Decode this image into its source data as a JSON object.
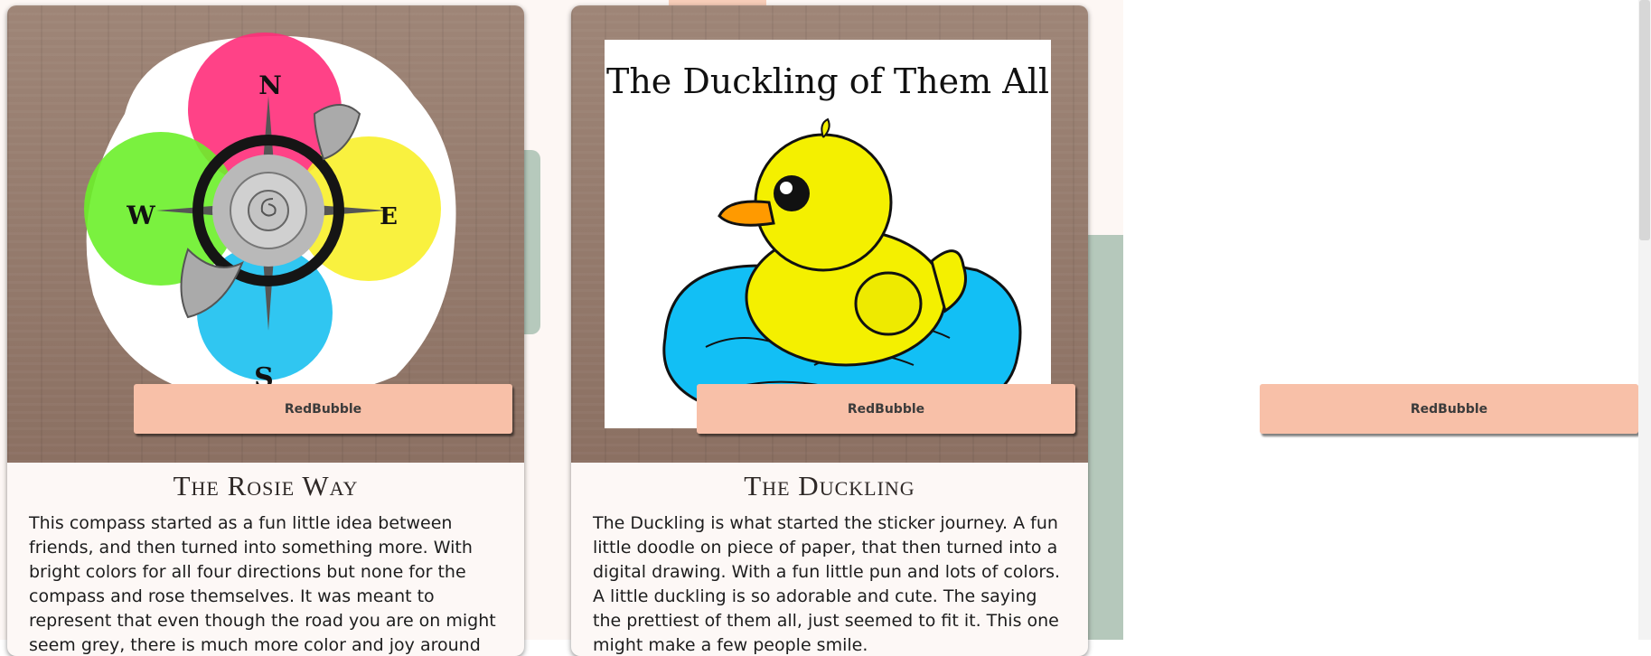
{
  "cards": [
    {
      "title": "The Rosie Way",
      "button_label": "RedBubble",
      "sticker_letters": {
        "n": "N",
        "e": "E",
        "s": "S",
        "w": "W"
      },
      "description": "This compass started as a fun little idea between friends, and then turned into something more. With bright colors for all four directions but none for the compass and rose themselves. It was meant to represent that even though the road you are on might seem grey, there is much more color and joy around you."
    },
    {
      "title": "The Duckling",
      "button_label": "RedBubble",
      "sticker_text": "The Duckling of Them All",
      "description": "The Duckling is what started the sticker journey. A fun little doodle on piece of paper, that then turned into a digital drawing. With a fun little pun and lots of colors. A little duckling is so adorable and cute. The saying the prettiest of them all, just seemed to fit it. This one might make a few people smile."
    }
  ],
  "third_button_label": "RedBubble",
  "colors": {
    "button": "#f8c0a8",
    "accent_green": "#b5c8bb",
    "card_bg": "#fdf8f6",
    "page_bg": "#fdf7f4"
  }
}
